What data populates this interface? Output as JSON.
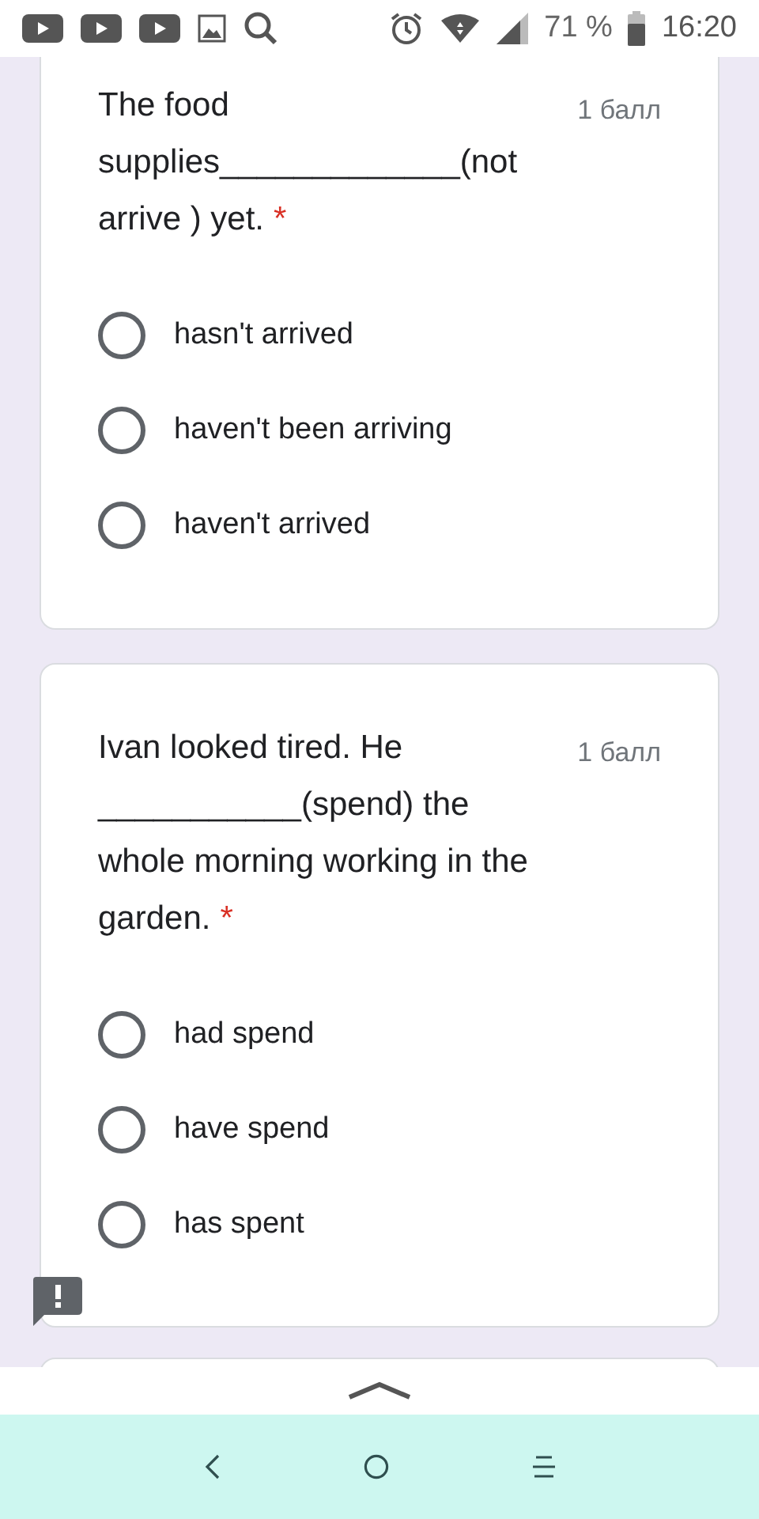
{
  "status_bar": {
    "battery": "71 %",
    "time": "16:20"
  },
  "questions": [
    {
      "text": "The food supplies_____________(not arrive ) yet.",
      "points": "1 балл",
      "required_mark": "*",
      "options": [
        {
          "label": "hasn't arrived",
          "selected": false
        },
        {
          "label": "haven't been arriving",
          "selected": false
        },
        {
          "label": "haven't arrived",
          "selected": false
        }
      ]
    },
    {
      "text": "Ivan looked tired. He ___________(spend) the whole morning working in the garden.",
      "points": "1 балл",
      "required_mark": "*",
      "options": [
        {
          "label": "had spend",
          "selected": false
        },
        {
          "label": "have spend",
          "selected": false
        },
        {
          "label": "has spent",
          "selected": false
        }
      ]
    }
  ]
}
